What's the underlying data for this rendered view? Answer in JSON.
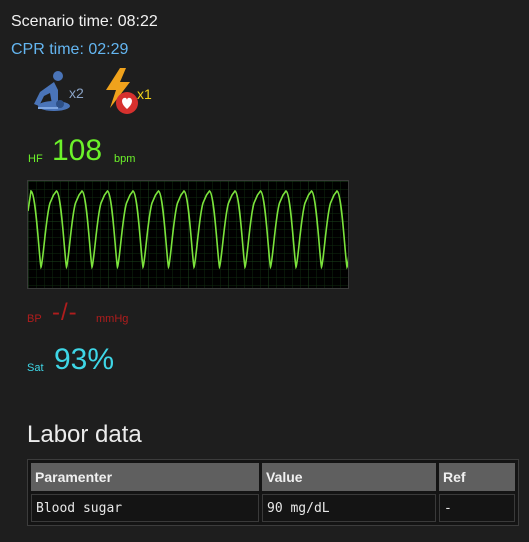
{
  "scenario_time": "Scenario time: 08:22",
  "cpr_time": "CPR time: 02:29",
  "counters": {
    "cpr_count": "x2",
    "shock_count": "x1"
  },
  "vitals": {
    "hr": {
      "label": "HF",
      "value": "108",
      "unit": "bpm",
      "color": "#6cf22a"
    },
    "bp": {
      "label": "BP",
      "value": "-/-",
      "unit": "mmHg",
      "color": "#b01d1d"
    },
    "sat": {
      "label": "Sat",
      "value": "93%",
      "color": "#3ed6e6"
    }
  },
  "labor": {
    "title": "Labor data",
    "columns": [
      "Paramenter",
      "Value",
      "Ref"
    ],
    "rows": [
      [
        "Blood sugar",
        "90 mg/dL",
        "-"
      ]
    ]
  }
}
